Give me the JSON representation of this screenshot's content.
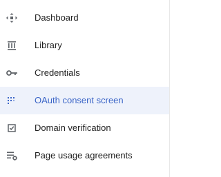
{
  "colors": {
    "text": "#212121",
    "icon": "#5f6368",
    "active_text": "#3b65c7",
    "active_background": "#eef2fb"
  },
  "sidebar": {
    "items": [
      {
        "label": "Dashboard",
        "icon": "dashboard-icon",
        "active": false
      },
      {
        "label": "Library",
        "icon": "library-icon",
        "active": false
      },
      {
        "label": "Credentials",
        "icon": "key-icon",
        "active": false
      },
      {
        "label": "OAuth consent screen",
        "icon": "consent-grid-icon",
        "active": true
      },
      {
        "label": "Domain verification",
        "icon": "checkbox-icon",
        "active": false
      },
      {
        "label": "Page usage agreements",
        "icon": "settings-list-icon",
        "active": false
      }
    ]
  }
}
